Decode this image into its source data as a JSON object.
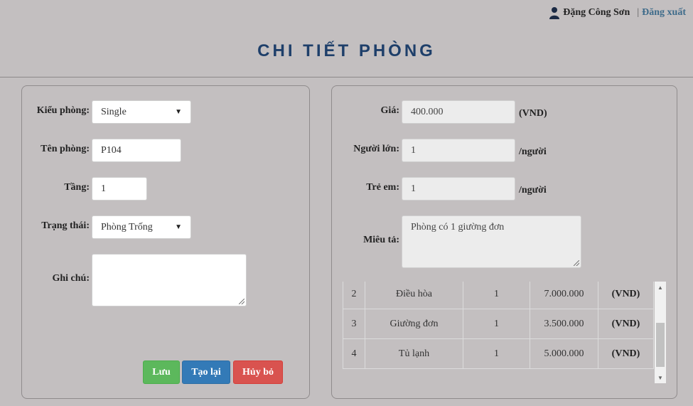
{
  "header": {
    "user_name": "Đặng Công Sơn",
    "separator": "|",
    "logout_label": "Đăng xuất"
  },
  "page": {
    "title": "CHI TIẾT PHÒNG"
  },
  "left_form": {
    "room_type": {
      "label": "Kiểu phòng:",
      "value": "Single"
    },
    "room_name": {
      "label": "Tên phòng:",
      "value": "P104"
    },
    "floor": {
      "label": "Tầng:",
      "value": "1"
    },
    "status": {
      "label": "Trạng thái:",
      "value": "Phòng Trống"
    },
    "note": {
      "label": "Ghi chú:",
      "value": ""
    }
  },
  "buttons": {
    "save": "Lưu",
    "reset": "Tạo lại",
    "cancel": "Hủy bỏ"
  },
  "right_form": {
    "price": {
      "label": "Giá:",
      "value": "400.000",
      "unit": "(VND)"
    },
    "adults": {
      "label": "Người lớn:",
      "value": "1",
      "unit": "/người"
    },
    "children": {
      "label": "Trẻ em:",
      "value": "1",
      "unit": "/người"
    },
    "description": {
      "label": "Miêu tả:",
      "value": "Phòng có 1 giường đơn"
    }
  },
  "equipment_table": {
    "rows": [
      {
        "no": "2",
        "name": "Điều hòa",
        "qty": "1",
        "price": "7.000.000",
        "unit": "(VND)"
      },
      {
        "no": "3",
        "name": "Giường đơn",
        "qty": "1",
        "price": "3.500.000",
        "unit": "(VND)"
      },
      {
        "no": "4",
        "name": "Tủ lạnh",
        "qty": "1",
        "price": "5.000.000",
        "unit": "(VND)"
      }
    ]
  },
  "icons": {
    "user": "user-icon",
    "dropdown": "chevron-down-icon",
    "scroll_up": "scroll-up-icon",
    "scroll_down": "scroll-down-icon"
  },
  "colors": {
    "background": "#c3bfc0",
    "title": "#1e3f6a",
    "save": "#5cb85c",
    "reset": "#337ab7",
    "cancel": "#d9534f",
    "logout": "#3e6b8a"
  }
}
